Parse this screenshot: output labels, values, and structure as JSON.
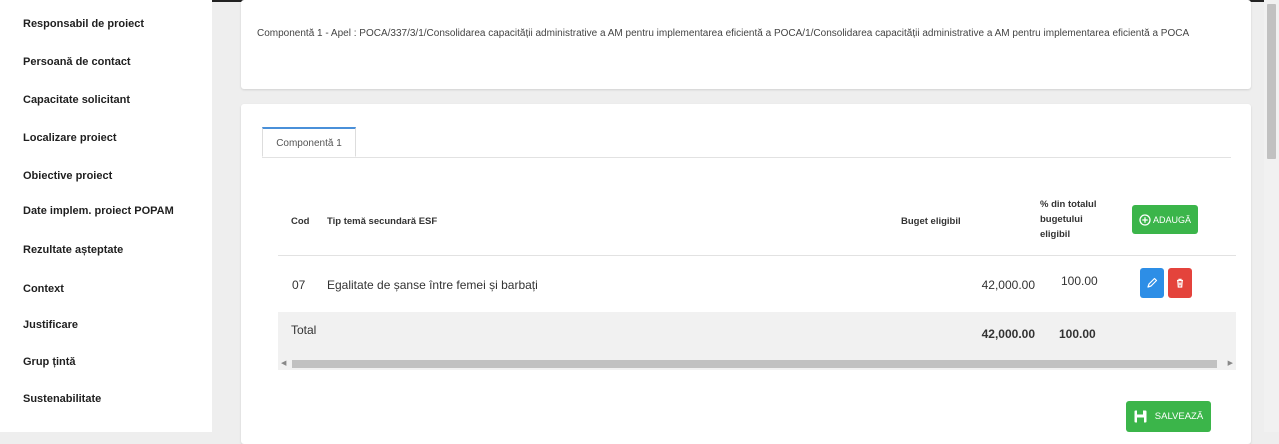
{
  "sidebar": {
    "items": [
      {
        "label": "Responsabil de proiect"
      },
      {
        "label": "Persoană de contact"
      },
      {
        "label": "Capacitate solicitant"
      },
      {
        "label": "Localizare proiect"
      },
      {
        "label": "Obiective proiect"
      },
      {
        "label": "Date implem. proiect POPAM"
      },
      {
        "label": "Rezultate așteptate"
      },
      {
        "label": "Context"
      },
      {
        "label": "Justificare"
      },
      {
        "label": "Grup țintă"
      },
      {
        "label": "Sustenabilitate"
      }
    ]
  },
  "header": {
    "description": "Componentă 1 - Apel : POCA/337/3/1/Consolidarea capacității administrative a AM pentru implementarea eficientă a POCA/1/Consolidarea capacității administrative a AM pentru implementarea eficientă a POCA"
  },
  "tabs": [
    {
      "label": "Componentă 1"
    }
  ],
  "table": {
    "headers": {
      "code": "Cod",
      "theme": "Tip temă secundară ESF",
      "budget": "Buget eligibil",
      "percent_line1": "% din totalul",
      "percent_line2": "bugetului",
      "percent_line3": "eligibil"
    },
    "add_label": "ADAUGĂ",
    "rows": [
      {
        "code": "07",
        "theme": "Egalitate de șanse între femei și barbați",
        "budget": "42,000.00",
        "percent": "100.00"
      }
    ],
    "total": {
      "label": "Total",
      "budget": "42,000.00",
      "percent": "100.00"
    }
  },
  "save_label": "SALVEAZĂ",
  "colors": {
    "green": "#3bb54a",
    "blue": "#2d8ee6",
    "red": "#e4433c",
    "tab_accent": "#4a90d9"
  },
  "icons": {
    "add": "plus-circle-icon",
    "edit": "pencil-icon",
    "delete": "trash-icon",
    "save": "floppy-disk-icon"
  }
}
